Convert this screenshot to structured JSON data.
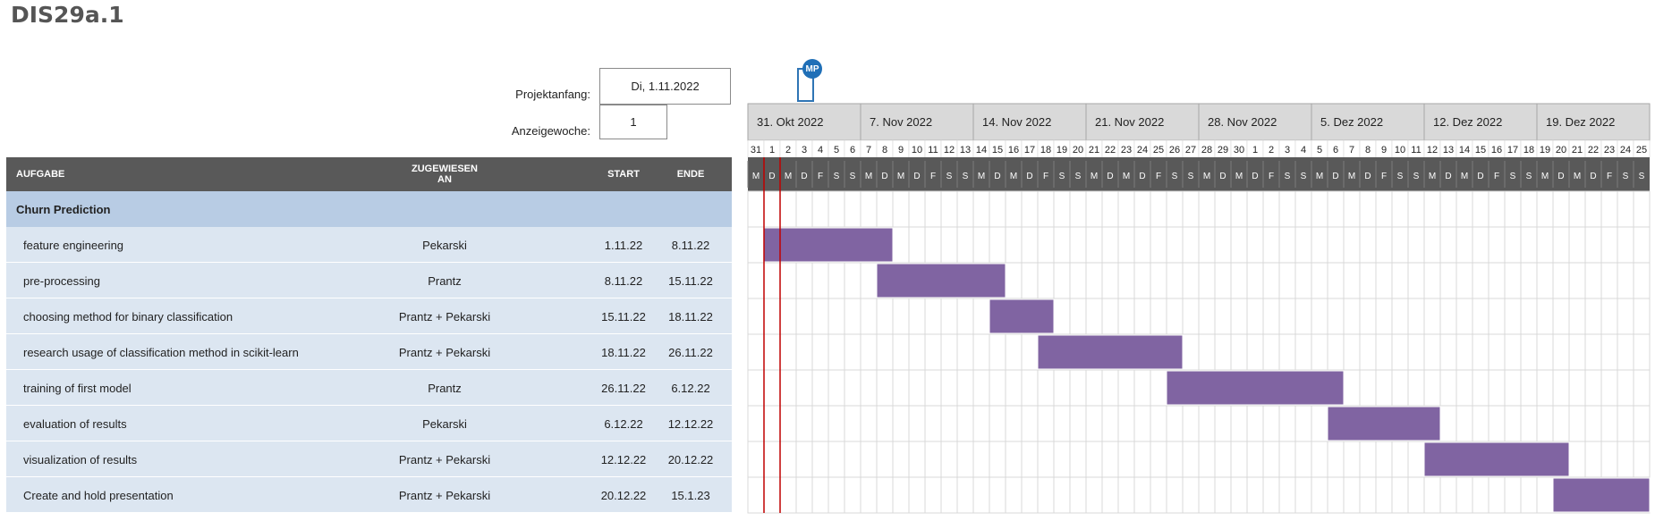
{
  "title": "DIS29a.1",
  "project": {
    "start_label": "Projektanfang:",
    "start_value": "Di, 1.11.2022",
    "week_label": "Anzeigewoche:",
    "week_value": "1",
    "marker_badge": "MP"
  },
  "columns": {
    "task": "AUFGABE",
    "assigned_line1": "ZUGEWIESEN",
    "assigned_line2": "AN",
    "start": "START",
    "end": "ENDE"
  },
  "timeline": {
    "weeks": [
      "31. Okt 2022",
      "7. Nov 2022",
      "14. Nov 2022",
      "21. Nov 2022",
      "28. Nov 2022",
      "5. Dez 2022",
      "12. Dez 2022",
      "19. Dez 2022"
    ],
    "day_numbers": [
      "31",
      "1",
      "2",
      "3",
      "4",
      "5",
      "6",
      "7",
      "8",
      "9",
      "10",
      "11",
      "12",
      "13",
      "14",
      "15",
      "16",
      "17",
      "18",
      "19",
      "20",
      "21",
      "22",
      "23",
      "24",
      "25",
      "26",
      "27",
      "28",
      "29",
      "30",
      "1",
      "2",
      "3",
      "4",
      "5",
      "6",
      "7",
      "8",
      "9",
      "10",
      "11",
      "12",
      "13",
      "14",
      "15",
      "16",
      "17",
      "18",
      "19",
      "20",
      "21",
      "22",
      "23",
      "24",
      "25"
    ],
    "day_letters": [
      "M",
      "D",
      "M",
      "D",
      "F",
      "S",
      "S"
    ],
    "today_index": 1
  },
  "phase": {
    "name": "Churn Prediction"
  },
  "tasks": [
    {
      "name": "feature engineering",
      "assigned": "Pekarski",
      "start": "1.11.22",
      "end": "8.11.22",
      "start_index": 1,
      "end_index": 8
    },
    {
      "name": "pre-processing",
      "assigned": "Prantz",
      "start": "8.11.22",
      "end": "15.11.22",
      "start_index": 8,
      "end_index": 15
    },
    {
      "name": "choosing method for binary classification",
      "assigned": "Prantz + Pekarski",
      "start": "15.11.22",
      "end": "18.11.22",
      "start_index": 15,
      "end_index": 18
    },
    {
      "name": "research usage of classification method in scikit-learn",
      "assigned": "Prantz + Pekarski",
      "start": "18.11.22",
      "end": "26.11.22",
      "start_index": 18,
      "end_index": 26
    },
    {
      "name": "training of first model",
      "assigned": "Prantz",
      "start": "26.11.22",
      "end": "6.12.22",
      "start_index": 26,
      "end_index": 36
    },
    {
      "name": "evaluation of results",
      "assigned": "Pekarski",
      "start": "6.12.22",
      "end": "12.12.22",
      "start_index": 36,
      "end_index": 42
    },
    {
      "name": "visualization of results",
      "assigned": "Prantz + Pekarski",
      "start": "12.12.22",
      "end": "20.12.22",
      "start_index": 42,
      "end_index": 50
    },
    {
      "name": "Create and hold presentation",
      "assigned": "Prantz + Pekarski",
      "start": "20.12.22",
      "end": "15.1.23",
      "start_index": 50,
      "end_index": 55
    }
  ],
  "colors": {
    "bar": "#8064a2",
    "today_line": "#c00000",
    "header": "#595959",
    "week_header": "#d9d9d9",
    "phase_row": "#b8cce4",
    "task_row": "#dce6f1"
  }
}
